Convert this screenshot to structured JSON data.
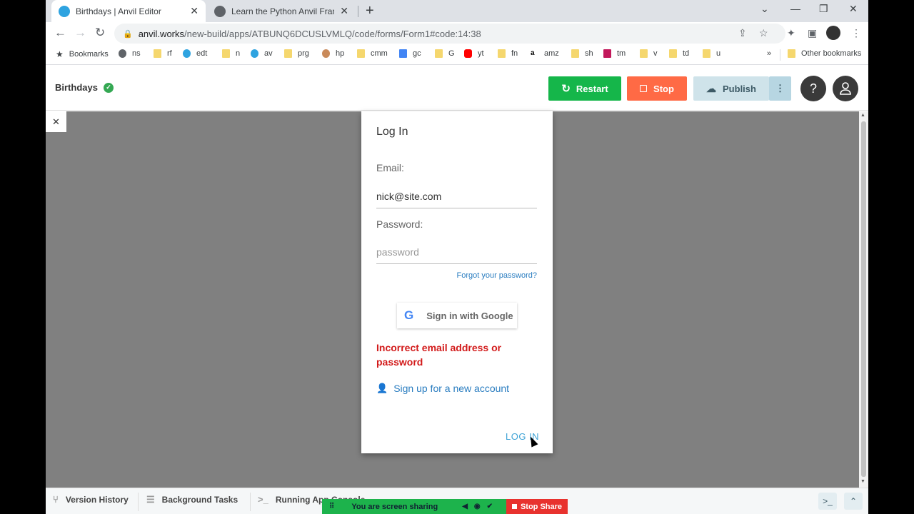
{
  "browser": {
    "tabs": [
      {
        "title": "Birthdays | Anvil Editor",
        "close": "✕"
      },
      {
        "title": "Learn the Python Anvil Framewo",
        "close": "✕"
      }
    ],
    "new_tab": "+",
    "window_controls": {
      "dropdown": "⌄",
      "minimize": "—",
      "restore": "❐",
      "close": "✕"
    },
    "url_host": "anvil.works",
    "url_path": "/new-build/apps/ATBUNQ6DCUSLVMLQ/code/forms/Form1#code:14:38",
    "bookmarks": [
      {
        "label": "Bookmarks",
        "icon": "star-icon"
      },
      {
        "label": "ns",
        "icon": "globe-icon"
      },
      {
        "label": "rf",
        "icon": "folder-icon"
      },
      {
        "label": "edt",
        "icon": "anvil-icon"
      },
      {
        "label": "n",
        "icon": "folder-icon"
      },
      {
        "label": "av",
        "icon": "anvil-icon"
      },
      {
        "label": "prg",
        "icon": "folder-icon"
      },
      {
        "label": "hp",
        "icon": "avatar-icon"
      },
      {
        "label": "cmm",
        "icon": "folder-icon"
      },
      {
        "label": "gc",
        "icon": "calendar-icon"
      },
      {
        "label": "G",
        "icon": "folder-icon"
      },
      {
        "label": "yt",
        "icon": "youtube-icon"
      },
      {
        "label": "fn",
        "icon": "folder-icon"
      },
      {
        "label": "amz",
        "icon": "amazon-icon"
      },
      {
        "label": "sh",
        "icon": "folder-icon"
      },
      {
        "label": "tm",
        "icon": "tm-icon"
      },
      {
        "label": "v",
        "icon": "folder-icon"
      },
      {
        "label": "td",
        "icon": "folder-icon"
      },
      {
        "label": "u",
        "icon": "folder-icon"
      }
    ],
    "bookmarks_overflow": "»",
    "other_bookmarks": "Other bookmarks"
  },
  "anvil": {
    "app_name": "Birthdays",
    "restart_label": "Restart",
    "stop_label": "Stop",
    "publish_label": "Publish",
    "more_label": "⋮"
  },
  "login": {
    "title": "Log In",
    "email_label": "Email:",
    "email_value": "nick@site.com",
    "password_label": "Password:",
    "password_placeholder": "password",
    "forgot_label": "Forgot your password?",
    "google_label": "Sign in with Google",
    "error_text": "Incorrect email address or password",
    "signup_label": "Sign up for a new account",
    "login_label": "LOG IN"
  },
  "bottom": {
    "version_history": "Version History",
    "background_tasks": "Background Tasks",
    "running_console": "Running App Console"
  },
  "share": {
    "status": "You are screen sharing",
    "stop_label": "Stop Share"
  },
  "colors": {
    "restart": "#15b64a",
    "stop": "#ff6a45",
    "publish": "#cfe3ea",
    "error": "#d21a1a",
    "link": "#2a7dc0"
  }
}
